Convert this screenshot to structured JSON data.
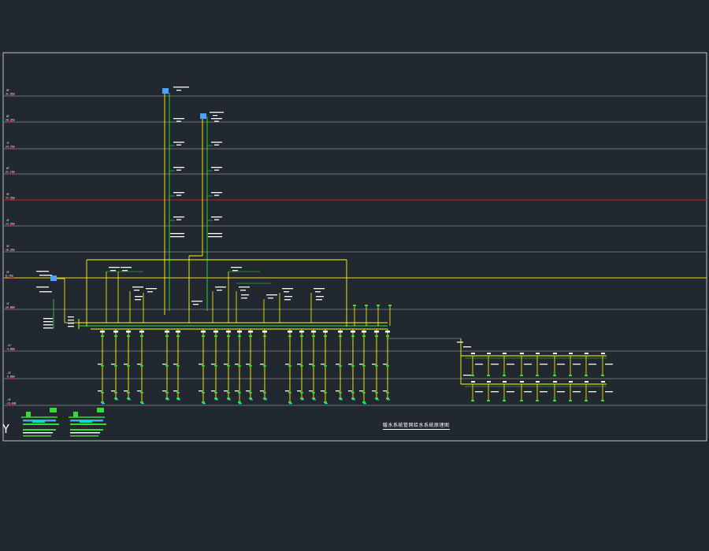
{
  "drawing": {
    "title": "暖水系统管网给水系统原理图",
    "ucs_icon": "ucs-y-axis-icon"
  },
  "colors": {
    "background": "#212830",
    "frame": "#e8e8e8",
    "floor_line": "#b9b9b9",
    "red_line": "#c0202a",
    "yellow_line": "#e6e600",
    "pipe_yellow": "#ffff00",
    "pipe_green": "#33dd33",
    "label_white": "#ffffff",
    "equip_blue": "#4aa3ff",
    "equip_cyan": "#00dddd"
  },
  "floor_levels": [
    {
      "label": "9F",
      "elev": "31.950"
    },
    {
      "label": "8F",
      "elev": "28.350"
    },
    {
      "label": "7F",
      "elev": "24.750"
    },
    {
      "label": "6F",
      "elev": "21.150"
    },
    {
      "label": "5F",
      "elev": "17.550"
    },
    {
      "label": "4F",
      "elev": "13.950"
    },
    {
      "label": "3F",
      "elev": "10.350"
    },
    {
      "label": "2F",
      "elev": "6.750"
    },
    {
      "label": "1F",
      "elev": "±0.000"
    },
    {
      "label": "-1F",
      "elev": "-4.800"
    },
    {
      "label": "-2F",
      "elev": "-9.600"
    },
    {
      "label": "-3F",
      "elev": "-13.400"
    }
  ]
}
